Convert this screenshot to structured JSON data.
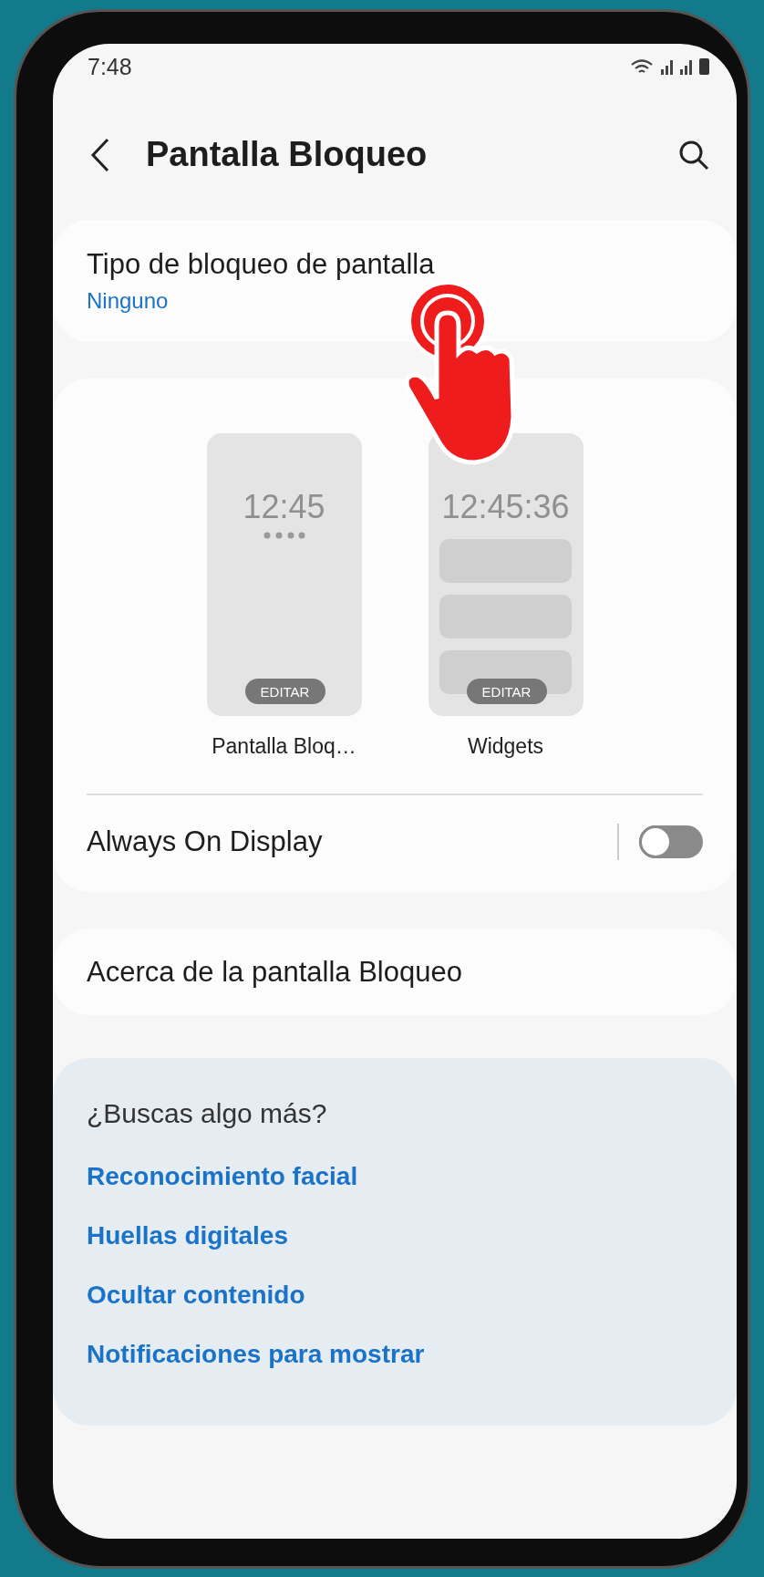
{
  "status_bar": {
    "time": "7:48"
  },
  "header": {
    "title": "Pantalla Bloqueo"
  },
  "lock_type": {
    "label": "Tipo de bloqueo de pantalla",
    "value": "Ninguno"
  },
  "previews": [
    {
      "kind": "pin",
      "clock": "12:45",
      "button": "EDITAR",
      "label": "Pantalla Bloq…"
    },
    {
      "kind": "widgets",
      "clock": "12:45:36",
      "button": "EDITAR",
      "label": "Widgets"
    }
  ],
  "always_on_display": {
    "label": "Always On Display",
    "on": false
  },
  "about": {
    "label": "Acerca de la pantalla Bloqueo"
  },
  "suggestions": {
    "title": "¿Buscas algo más?",
    "links": [
      "Reconocimiento facial",
      "Huellas digitales",
      "Ocultar contenido",
      "Notificaciones para mostrar"
    ]
  }
}
